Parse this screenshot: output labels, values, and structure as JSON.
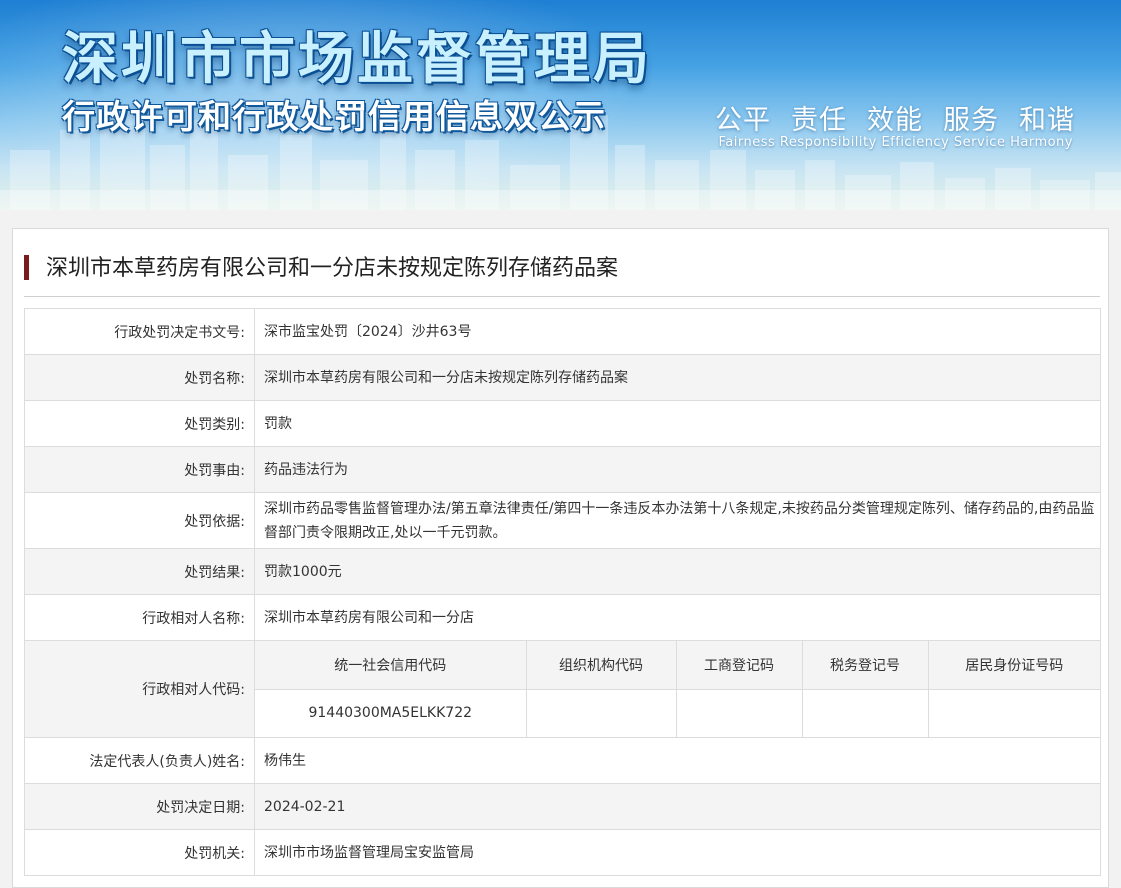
{
  "banner": {
    "title": "深圳市市场监督管理局",
    "subtitle": "行政许可和行政处罚信用信息双公示",
    "slogan_cn": [
      "公平",
      "责任",
      "效能",
      "服务",
      "和谐"
    ],
    "slogan_en": "Fairness  Responsibility  Efficiency  Service  Harmony"
  },
  "case": {
    "title": "深圳市本草药房有限公司和一分店未按规定陈列存储药品案"
  },
  "fields": {
    "doc_no": {
      "label": "行政处罚决定书文号:",
      "value": "深市监宝处罚〔2024〕沙井63号"
    },
    "penalty_name": {
      "label": "处罚名称:",
      "value": "深圳市本草药房有限公司和一分店未按规定陈列存储药品案"
    },
    "penalty_type": {
      "label": "处罚类别:",
      "value": "罚款"
    },
    "penalty_reason": {
      "label": "处罚事由:",
      "value": "药品违法行为"
    },
    "penalty_basis": {
      "label": "处罚依据:",
      "value": "深圳市药品零售监督管理办法/第五章法律责任/第四十一条违反本办法第十八条规定,未按药品分类管理规定陈列、储存药品的,由药品监督部门责令限期改正,处以一千元罚款。"
    },
    "penalty_result": {
      "label": "处罚结果:",
      "value": "罚款1000元"
    },
    "party_name": {
      "label": "行政相对人名称:",
      "value": "深圳市本草药房有限公司和一分店"
    },
    "party_code": {
      "label": "行政相对人代码:",
      "headers": [
        "统一社会信用代码",
        "组织机构代码",
        "工商登记码",
        "税务登记号",
        "居民身份证号码"
      ],
      "values": [
        "91440300MA5ELKK722",
        "",
        "",
        "",
        ""
      ]
    },
    "legal_rep": {
      "label": "法定代表人(负责人)姓名:",
      "value": "杨伟生"
    },
    "decision_date": {
      "label": "处罚决定日期:",
      "value": "2024-02-21"
    },
    "authority": {
      "label": "处罚机关:",
      "value": "深圳市市场监督管理局宝安监管局"
    }
  }
}
